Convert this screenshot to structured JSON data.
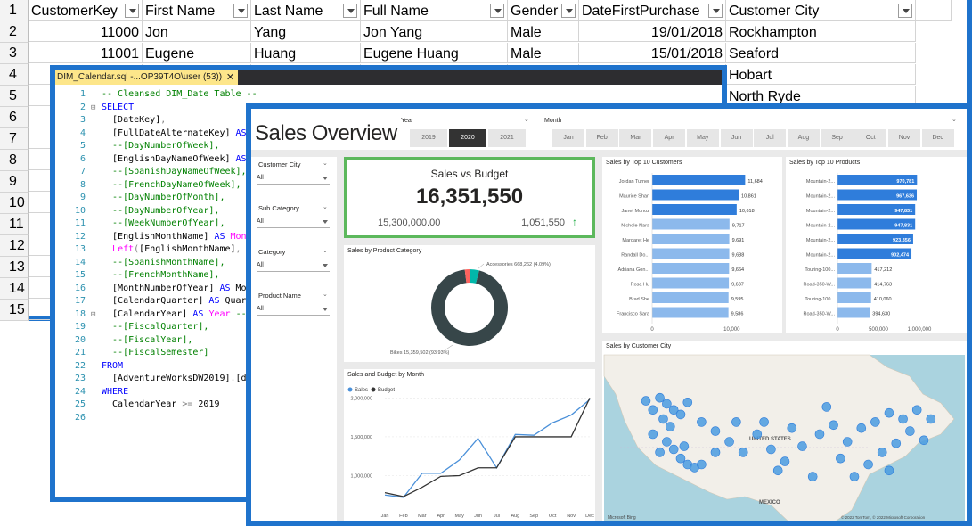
{
  "excel": {
    "headers": [
      "CustomerKey",
      "First Name",
      "Last Name",
      "Full Name",
      "Gender",
      "DateFirstPurchase",
      "Customer City"
    ],
    "row_numbers": [
      "1",
      "2",
      "3",
      "4",
      "5",
      "6",
      "7",
      "8",
      "9",
      "10",
      "11",
      "12",
      "13",
      "14",
      "15"
    ],
    "rows": [
      [
        "11000",
        "Jon",
        "Yang",
        "Jon Yang",
        "Male",
        "19/01/2018",
        "Rockhampton"
      ],
      [
        "11001",
        "Eugene",
        "Huang",
        "Eugene Huang",
        "Male",
        "15/01/2018",
        "Seaford"
      ],
      [
        "",
        "",
        "",
        "",
        "",
        "",
        "Hobart"
      ],
      [
        "",
        "",
        "",
        "",
        "",
        "",
        "North Ryde"
      ]
    ]
  },
  "sql": {
    "tab_title": "DIM_Calendar.sql -...OP39T4O\\user (53))",
    "tab_close": "✕",
    "lines": [
      {
        "n": "1",
        "fold": "",
        "html": "<span class=\"c\">-- Cleansed DIM_Date Table --</span>"
      },
      {
        "n": "2",
        "fold": "⊟",
        "html": "<span class=\"k\">SELECT</span>"
      },
      {
        "n": "3",
        "fold": "",
        "html": "  [DateKey]<span class=\"g\">,</span>"
      },
      {
        "n": "4",
        "fold": "",
        "html": "  [FullDateAlternateKey] <span class=\"k\">AS</span> Date<span class=\"g\">,</span>"
      },
      {
        "n": "5",
        "fold": "",
        "html": "  <span class=\"c\">--[DayNumberOfWeek],</span>"
      },
      {
        "n": "6",
        "fold": "",
        "html": "  [EnglishDayNameOfWeek] <span class=\"k\">AS</span> <span class=\"p\">Day</span><span class=\"g\">,</span>"
      },
      {
        "n": "7",
        "fold": "",
        "html": "  <span class=\"c\">--[SpanishDayNameOfWeek],</span>"
      },
      {
        "n": "8",
        "fold": "",
        "html": "  <span class=\"c\">--[FrenchDayNameOfWeek],</span>"
      },
      {
        "n": "9",
        "fold": "",
        "html": "  <span class=\"c\">--[DayNumberOfMonth],</span>"
      },
      {
        "n": "10",
        "fold": "",
        "html": "  <span class=\"c\">--[DayNumberOfYear],</span>"
      },
      {
        "n": "11",
        "fold": "",
        "html": "  <span class=\"c\">--[WeekNumberOfYear],</span>"
      },
      {
        "n": "12",
        "fold": "",
        "html": "  [EnglishMonthName] <span class=\"k\">AS</span> <span class=\"p\">Month</span><span class=\"g\">,</span>"
      },
      {
        "n": "13",
        "fold": "",
        "html": "  <span class=\"p\">Left</span><span class=\"g\">(</span>[EnglishMonthName]<span class=\"g\">,</span> 3<span class=\"g\">)</span> <span class=\"k\">AS</span>"
      },
      {
        "n": "14",
        "fold": "",
        "html": "  <span class=\"c\">--[SpanishMonthName],</span>"
      },
      {
        "n": "15",
        "fold": "",
        "html": "  <span class=\"c\">--[FrenchMonthName],</span>"
      },
      {
        "n": "16",
        "fold": "",
        "html": "  [MonthNumberOfYear] <span class=\"k\">AS</span> MonthNo<span class=\"g\">,</span>"
      },
      {
        "n": "17",
        "fold": "",
        "html": "  [CalendarQuarter] <span class=\"k\">AS</span> Quarter<span class=\"g\">,</span>"
      },
      {
        "n": "18",
        "fold": "⊟",
        "html": "  [CalendarYear] <span class=\"k\">AS</span> <span class=\"p\">Year</span> <span class=\"c\">--[Calen</span>"
      },
      {
        "n": "19",
        "fold": "",
        "html": "  <span class=\"c\">--[FiscalQuarter],</span>"
      },
      {
        "n": "20",
        "fold": "",
        "html": "  <span class=\"c\">--[FiscalYear],</span>"
      },
      {
        "n": "21",
        "fold": "",
        "html": "  <span class=\"c\">--[FiscalSemester]</span>"
      },
      {
        "n": "22",
        "fold": "",
        "html": "<span class=\"k\">FROM</span>"
      },
      {
        "n": "23",
        "fold": "",
        "html": "  [AdventureWorksDW2019]<span class=\"g\">.</span>[dbo]<span class=\"g\">.</span>[Di"
      },
      {
        "n": "24",
        "fold": "",
        "html": "<span class=\"k\">WHERE</span>"
      },
      {
        "n": "25",
        "fold": "",
        "html": "  CalendarYear <span class=\"g\">&gt;=</span> 2019"
      },
      {
        "n": "26",
        "fold": "",
        "html": ""
      }
    ]
  },
  "report": {
    "title": "Sales Overview",
    "year_label": "Year",
    "years": [
      "2019",
      "2020",
      "2021"
    ],
    "selected_year": "2020",
    "month_label": "Month",
    "months": [
      "Jan",
      "Feb",
      "Mar",
      "Apr",
      "May",
      "Jun",
      "Jul",
      "Aug",
      "Sep",
      "Oct",
      "Nov",
      "Dec"
    ],
    "slicers": [
      {
        "label": "Customer City",
        "value": "All"
      },
      {
        "label": "Sub Category",
        "value": "All"
      },
      {
        "label": "Category",
        "value": "All"
      },
      {
        "label": "Product Name",
        "value": "All"
      }
    ],
    "kpi": {
      "title": "Sales vs Budget",
      "value": "16,351,550",
      "budget": "15,300,000.00",
      "variance": "1,051,550",
      "variance_color": "#1aab40",
      "border_color": "#5cb85c"
    },
    "accent_colors": {
      "bar_dark": "#2f7ddb",
      "bar_light": "#8cb9ec",
      "bikes": "#374649",
      "accessories": "#01b8aa",
      "clothing": "#fd625e",
      "sales_line": "#4a90d9",
      "budget_line": "#333333"
    }
  },
  "chart_data": [
    {
      "type": "bar",
      "title": "Sales by Top 10 Customers",
      "categories": [
        "Jordan Turner",
        "Maurice Shan",
        "Janet Munoz",
        "Nichole Nara",
        "Margaret He",
        "Randall Do...",
        "Adriana Gon...",
        "Rosa Hu",
        "Brad She",
        "Francisco Sara"
      ],
      "values": [
        11684,
        10861,
        10618,
        9717,
        9691,
        9688,
        9664,
        9637,
        9595,
        9586
      ],
      "value_labels": [
        "11,684",
        "10,861",
        "10,618",
        "9,717",
        "9,691",
        "9,688",
        "9,664",
        "9,637",
        "9,595",
        "9,586"
      ],
      "xticks": [
        "0",
        "10,000"
      ],
      "xlim": [
        0,
        15000
      ]
    },
    {
      "type": "bar",
      "title": "Sales by Top 10 Products",
      "categories": [
        "Mountain-2...",
        "Mountain-2...",
        "Mountain-2...",
        "Mountain-2...",
        "Mountain-2...",
        "Mountain-2...",
        "Touring-100...",
        "Road-350-W...",
        "Touring-100...",
        "Road-350-W..."
      ],
      "values": [
        970781,
        967636,
        947831,
        947831,
        923356,
        902474,
        417212,
        414763,
        410060,
        394630
      ],
      "value_labels": [
        "970,781",
        "967,636",
        "947,831",
        "947,831",
        "923,356",
        "902,474",
        "417,212",
        "414,763",
        "410,060",
        "394,630"
      ],
      "xticks": [
        "0",
        "500,000",
        "1,000,000"
      ],
      "xlim": [
        0,
        1000000
      ]
    },
    {
      "type": "pie",
      "title": "Sales by Product Category",
      "categories": [
        "Bikes",
        "Accessories",
        "Clothing"
      ],
      "values": [
        15359502,
        668262,
        323786
      ],
      "labels": [
        "Bikes 15,359,502 (93.93%)",
        "Accessories 668,262 (4.09%)"
      ]
    },
    {
      "type": "line",
      "title": "Sales and Budget by Month",
      "categories": [
        "Jan",
        "Feb",
        "Mar",
        "Apr",
        "May",
        "Jun",
        "Jul",
        "Aug",
        "Sep",
        "Oct",
        "Nov",
        "Dec"
      ],
      "series": [
        {
          "name": "Sales",
          "values": [
            750000,
            720000,
            1030000,
            1030000,
            1200000,
            1480000,
            1100000,
            1530000,
            1520000,
            1680000,
            1780000,
            1980000
          ]
        },
        {
          "name": "Budget",
          "values": [
            780000,
            730000,
            850000,
            990000,
            1000000,
            1100000,
            1100000,
            1500000,
            1500000,
            1500000,
            1500000,
            2000000
          ]
        }
      ],
      "yticks": [
        "1,000,000",
        "1,500,000",
        "2,000,000"
      ],
      "ylim": [
        650000,
        2050000
      ]
    }
  ],
  "map": {
    "title": "Sales by Customer City",
    "country_label": "UNITED STATES",
    "mexico_label": "MEXICO",
    "credit": "© 2022 TomTom, © 2022 Microsoft Corporation",
    "brand": "Microsoft Bing",
    "bubble_color": "#4a9be0",
    "bubble_points": [
      [
        0.14,
        0.26
      ],
      [
        0.16,
        0.3
      ],
      [
        0.18,
        0.34
      ],
      [
        0.15,
        0.4
      ],
      [
        0.17,
        0.45
      ],
      [
        0.2,
        0.37
      ],
      [
        0.22,
        0.29
      ],
      [
        0.12,
        0.34
      ],
      [
        0.16,
        0.55
      ],
      [
        0.18,
        0.6
      ],
      [
        0.14,
        0.62
      ],
      [
        0.2,
        0.66
      ],
      [
        0.22,
        0.7
      ],
      [
        0.24,
        0.72
      ],
      [
        0.26,
        0.7
      ],
      [
        0.21,
        0.58
      ],
      [
        0.3,
        0.48
      ],
      [
        0.34,
        0.55
      ],
      [
        0.38,
        0.62
      ],
      [
        0.42,
        0.5
      ],
      [
        0.46,
        0.6
      ],
      [
        0.5,
        0.68
      ],
      [
        0.55,
        0.58
      ],
      [
        0.6,
        0.5
      ],
      [
        0.64,
        0.44
      ],
      [
        0.68,
        0.55
      ],
      [
        0.72,
        0.46
      ],
      [
        0.76,
        0.42
      ],
      [
        0.8,
        0.36
      ],
      [
        0.84,
        0.4
      ],
      [
        0.86,
        0.48
      ],
      [
        0.82,
        0.56
      ],
      [
        0.78,
        0.62
      ],
      [
        0.74,
        0.7
      ],
      [
        0.7,
        0.78
      ],
      [
        0.88,
        0.34
      ],
      [
        0.92,
        0.4
      ],
      [
        0.58,
        0.78
      ],
      [
        0.48,
        0.74
      ],
      [
        0.44,
        0.42
      ],
      [
        0.36,
        0.42
      ],
      [
        0.52,
        0.46
      ],
      [
        0.66,
        0.66
      ],
      [
        0.8,
        0.74
      ],
      [
        0.26,
        0.42
      ],
      [
        0.3,
        0.62
      ],
      [
        0.62,
        0.32
      ],
      [
        0.1,
        0.28
      ],
      [
        0.9,
        0.54
      ],
      [
        0.12,
        0.5
      ]
    ]
  }
}
